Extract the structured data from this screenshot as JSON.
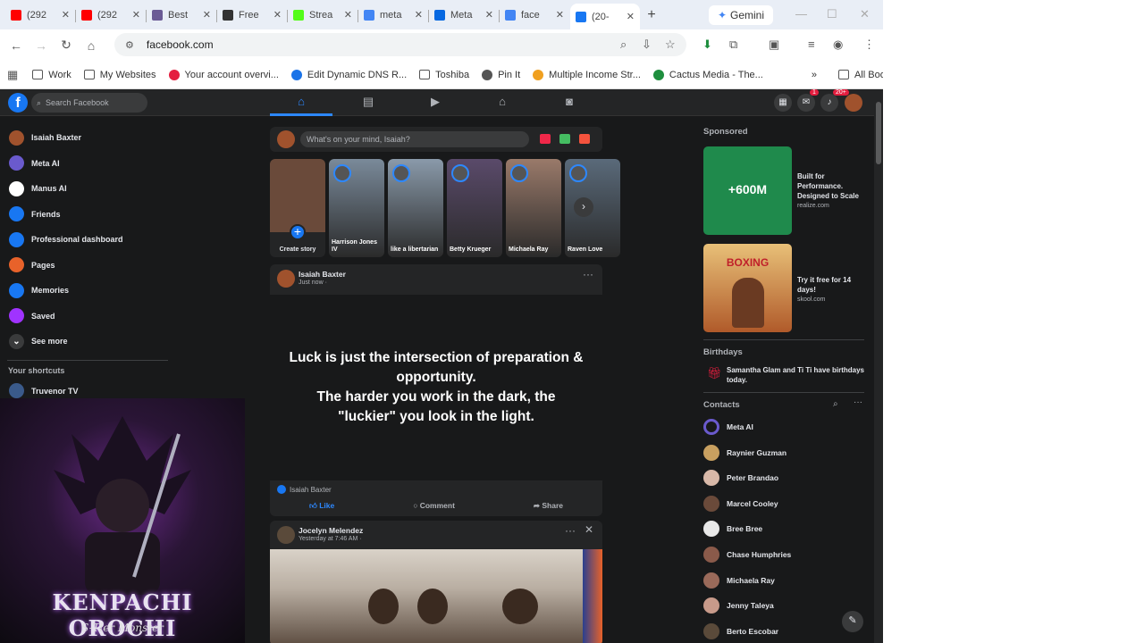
{
  "browser": {
    "tabs": [
      {
        "label": "(292",
        "color": "#ff0000"
      },
      {
        "label": "(292",
        "color": "#ff0000"
      },
      {
        "label": "Best",
        "color": "#6b5b95"
      },
      {
        "label": "Free",
        "color": "#333333"
      },
      {
        "label": "Strea",
        "color": "#53fc18"
      },
      {
        "label": "meta",
        "color": "#4285f4"
      },
      {
        "label": "Meta",
        "color": "#0668e1"
      },
      {
        "label": "face",
        "color": "#4285f4"
      },
      {
        "label": "(20-",
        "color": "#1877f2"
      }
    ],
    "new_tab": "+",
    "gemini_label": "Gemini",
    "url": "facebook.com",
    "bookmarks": [
      "Work",
      "My Websites",
      "Your account overvi...",
      "Edit Dynamic DNS R...",
      "Toshiba",
      "Pin It",
      "Multiple Income Str...",
      "Cactus Media - The..."
    ],
    "all_bookmarks": "All Bookmarks",
    "more_bookmarks": "»"
  },
  "facebook": {
    "logo": "f",
    "search_placeholder": "Search Facebook",
    "messenger_badge": "1",
    "notif_badge": "20+",
    "left_items": [
      {
        "label": "Isaiah Baxter",
        "color": "#a0522d",
        "icon": "avatar"
      },
      {
        "label": "Meta AI",
        "color": "#6a5acd",
        "icon": "meta-ai-icon"
      },
      {
        "label": "Manus AI",
        "color": "#ffffff",
        "icon": "manus-icon"
      },
      {
        "label": "Friends",
        "color": "#1877f2",
        "icon": "friends-icon"
      },
      {
        "label": "Professional dashboard",
        "color": "#1877f2",
        "icon": "dashboard-icon"
      },
      {
        "label": "Pages",
        "color": "#e8622a",
        "icon": "pages-icon"
      },
      {
        "label": "Memories",
        "color": "#1877f2",
        "icon": "memories-icon"
      },
      {
        "label": "Saved",
        "color": "#a033ff",
        "icon": "saved-icon"
      },
      {
        "label": "See more",
        "color": "#3a3b3c",
        "icon": "chevron-down-icon"
      }
    ],
    "shortcuts_title": "Your shortcuts",
    "shortcut": "Truvenor TV",
    "overlay": {
      "title": "KENPACHI OROCHI",
      "subtitle": "S-Tier Monster"
    },
    "composer_placeholder": "What's on your mind, Isaiah?",
    "stories": [
      {
        "name": "Create story",
        "color": "#6a4a3a"
      },
      {
        "name": "Harrison Jones IV",
        "color": "#7a8a9a"
      },
      {
        "name": "like a libertarian",
        "color": "#8a9aaa"
      },
      {
        "name": "Betty Krueger",
        "color": "#5a4a6a"
      },
      {
        "name": "Michaela Ray",
        "color": "#9a7a6a"
      },
      {
        "name": "Raven Love",
        "color": "#5a6a7a"
      }
    ],
    "post1": {
      "author": "Isaiah Baxter",
      "time": "Just now ·",
      "line1": "Luck is just the intersection of preparation & opportunity.",
      "line2": "The harder you work in the dark, the \"luckier\" you look in the light.",
      "reactor": "Isaiah Baxter",
      "like": "Like",
      "comment": "Comment",
      "share": "Share"
    },
    "post2": {
      "author": "Jocelyn Melendez",
      "time": "Yesterday at 7:46 AM ·"
    },
    "sponsored_title": "Sponsored",
    "ads": [
      {
        "text": "Built for Performance. Designed to Scale",
        "domain": "realize.com",
        "img_text": "+600M"
      },
      {
        "text": "Try it free for 14 days!",
        "domain": "skool.com",
        "img_text": "BOXING"
      }
    ],
    "birthdays_title": "Birthdays",
    "birthday_text": "Samantha Glam and Ti Ti have birthdays today.",
    "contacts_title": "Contacts",
    "contacts": [
      {
        "name": "Meta AI",
        "color": "#6a5acd"
      },
      {
        "name": "Raynier Guzman",
        "color": "#c8a060"
      },
      {
        "name": "Peter Brandao",
        "color": "#d8b8a8"
      },
      {
        "name": "Marcel Cooley",
        "color": "#6a4a3a"
      },
      {
        "name": "Bree Bree",
        "color": "#e8e8e8"
      },
      {
        "name": "Chase Humphries",
        "color": "#8a5a4a"
      },
      {
        "name": "Michaela Ray",
        "color": "#9a6a5a"
      },
      {
        "name": "Jenny Taleya",
        "color": "#c89a8a"
      },
      {
        "name": "Berto Escobar",
        "color": "#5a4a3a"
      }
    ]
  }
}
